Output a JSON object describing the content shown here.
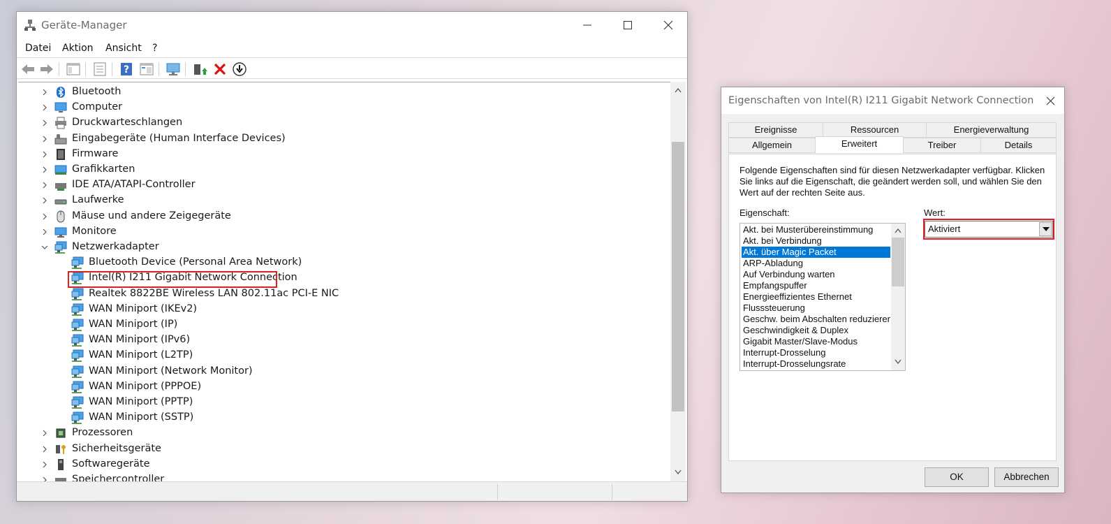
{
  "device_manager": {
    "title": "Geräte-Manager",
    "menu": [
      "Datei",
      "Aktion",
      "Ansicht",
      "?"
    ],
    "toolbar_icons": [
      "back-icon",
      "forward-icon",
      "show-hide-console-tree-icon",
      "properties-icon",
      "help-icon",
      "view-icon",
      "scan-hardware-icon",
      "update-driver-icon",
      "uninstall-icon",
      "disable-device-icon"
    ],
    "tree": [
      {
        "label": "Bluetooth",
        "icon": "bluetooth-icon",
        "level": 0,
        "expanded": false
      },
      {
        "label": "Computer",
        "icon": "computer-icon",
        "level": 0,
        "expanded": false
      },
      {
        "label": "Druckwarteschlangen",
        "icon": "printer-icon",
        "level": 0,
        "expanded": false
      },
      {
        "label": "Eingabegeräte (Human Interface Devices)",
        "icon": "hid-icon",
        "level": 0,
        "expanded": false
      },
      {
        "label": "Firmware",
        "icon": "firmware-icon",
        "level": 0,
        "expanded": false
      },
      {
        "label": "Grafikkarten",
        "icon": "display-adapter-icon",
        "level": 0,
        "expanded": false
      },
      {
        "label": "IDE ATA/ATAPI-Controller",
        "icon": "ide-controller-icon",
        "level": 0,
        "expanded": false
      },
      {
        "label": "Laufwerke",
        "icon": "disk-drive-icon",
        "level": 0,
        "expanded": false
      },
      {
        "label": "Mäuse und andere Zeigegeräte",
        "icon": "mouse-icon",
        "level": 0,
        "expanded": false
      },
      {
        "label": "Monitore",
        "icon": "monitor-icon",
        "level": 0,
        "expanded": false
      },
      {
        "label": "Netzwerkadapter",
        "icon": "network-adapter-icon",
        "level": 0,
        "expanded": true
      },
      {
        "label": "Bluetooth Device (Personal Area Network)",
        "icon": "network-adapter-icon",
        "level": 1
      },
      {
        "label": "Intel(R) I211 Gigabit Network Connection",
        "icon": "network-adapter-icon",
        "level": 1,
        "highlighted": true
      },
      {
        "label": "Realtek 8822BE Wireless LAN 802.11ac PCI-E NIC",
        "icon": "network-adapter-icon",
        "level": 1
      },
      {
        "label": "WAN Miniport (IKEv2)",
        "icon": "network-adapter-icon",
        "level": 1
      },
      {
        "label": "WAN Miniport (IP)",
        "icon": "network-adapter-icon",
        "level": 1
      },
      {
        "label": "WAN Miniport (IPv6)",
        "icon": "network-adapter-icon",
        "level": 1
      },
      {
        "label": "WAN Miniport (L2TP)",
        "icon": "network-adapter-icon",
        "level": 1
      },
      {
        "label": "WAN Miniport (Network Monitor)",
        "icon": "network-adapter-icon",
        "level": 1
      },
      {
        "label": "WAN Miniport (PPPOE)",
        "icon": "network-adapter-icon",
        "level": 1
      },
      {
        "label": "WAN Miniport (PPTP)",
        "icon": "network-adapter-icon",
        "level": 1
      },
      {
        "label": "WAN Miniport (SSTP)",
        "icon": "network-adapter-icon",
        "level": 1
      },
      {
        "label": "Prozessoren",
        "icon": "processor-icon",
        "level": 0,
        "expanded": false
      },
      {
        "label": "Sicherheitsgeräte",
        "icon": "security-device-icon",
        "level": 0,
        "expanded": false
      },
      {
        "label": "Softwaregeräte",
        "icon": "software-device-icon",
        "level": 0,
        "expanded": false
      },
      {
        "label": "Speichercontroller",
        "icon": "storage-controller-icon",
        "level": 0,
        "expanded": false
      }
    ]
  },
  "properties_dialog": {
    "title": "Eigenschaften von Intel(R) I211 Gigabit Network Connection",
    "tabs_row1": [
      "Ereignisse",
      "Ressourcen",
      "Energieverwaltung"
    ],
    "tabs_row2": [
      "Allgemein",
      "Erweitert",
      "Treiber",
      "Details"
    ],
    "active_tab": "Erweitert",
    "description": "Folgende Eigenschaften sind für diesen Netzwerkadapter verfügbar. Klicken Sie links auf die Eigenschaft, die geändert werden soll, und wählen Sie den Wert auf der rechten Seite aus.",
    "property_label": "Eigenschaft:",
    "value_label": "Wert:",
    "properties": [
      "Akt. bei Musterübereinstimmung",
      "Akt. bei Verbindung",
      "Akt. über Magic Packet",
      "ARP-Abladung",
      "Auf Verbindung warten",
      "Empfangspuffer",
      "Energieeffizientes Ethernet",
      "Flusssteuerung",
      "Geschw. beim Abschalten reduzieren",
      "Geschwindigkeit & Duplex",
      "Gigabit Master/Slave-Modus",
      "Interrupt-Drosselung",
      "Interrupt-Drosselungsrate"
    ],
    "selected_property": "Akt. über Magic Packet",
    "value": "Aktiviert",
    "ok_label": "OK",
    "cancel_label": "Abbrechen"
  },
  "colors": {
    "selection": "#0078d7",
    "highlight_outline": "#e02020"
  }
}
